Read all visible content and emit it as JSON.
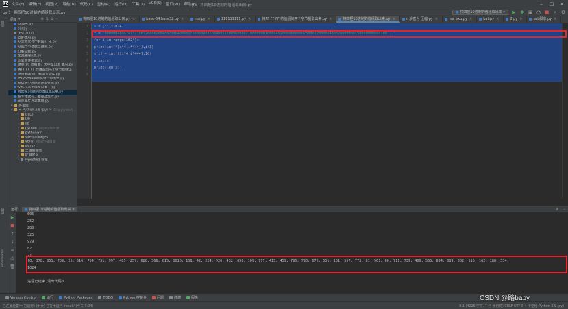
{
  "titlebar": {
    "menu": [
      "文件(F)",
      "编辑(E)",
      "视图(V)",
      "导航(N)",
      "代码(C)",
      "重构(R)",
      "运行(U)",
      "工具(T)",
      "VCS(S)",
      "窗口(W)",
      "帮助(H)"
    ],
    "title": "py - 将四把10进制的值组取出来.py"
  },
  "navbar": {
    "breadcrumb": "py 〉 将四把10进制的值组取出来.py",
    "run_config": "将四把10进制的值组取出来"
  },
  "left_strip": [
    "项目",
    "结构",
    "Bookmarks"
  ],
  "project": {
    "header": "项目",
    "tree": [
      {
        "type": "py",
        "label": "server.py"
      },
      {
        "type": "py",
        "label": "sql.py"
      },
      {
        "type": "txt",
        "label": "test16.txt"
      },
      {
        "type": "py",
        "label": "立即使用.py"
      },
      {
        "type": "py",
        "label": "从文档文件中解出n、e.py"
      },
      {
        "type": "py",
        "label": "从图片中读取二进制.py"
      },
      {
        "type": "py",
        "label": "分解因数.py"
      },
      {
        "type": "py",
        "label": "加减乘除n次.py"
      },
      {
        "type": "py",
        "label": "回复文件格式.py"
      },
      {
        "type": "py",
        "label": "读取 16 进制值、文本提出来 使用.py"
      },
      {
        "type": "py",
        "label": "将FF FF FF 的值组的两个字节提取出"
      },
      {
        "type": "py",
        "label": "批量删除5n、转换为文件.py"
      },
      {
        "type": "py",
        "label": "把base64编码部分打印出来.py"
      },
      {
        "type": "py",
        "label": "整体多个压缩包提取代码.py"
      },
      {
        "type": "py",
        "label": "文件拉字节值反过来了.py"
      },
      {
        "type": "py",
        "label": "将四把10进制的值组取出来.py",
        "selected": true
      },
      {
        "type": "py",
        "label": "解本格式化、整理成文件.py"
      },
      {
        "type": "py",
        "label": "还原图片真正宽度.py"
      },
      {
        "type": "folder",
        "label": "外部库",
        "arrow": "▾"
      },
      {
        "type": "folder",
        "label": "< Python 3.9 (py) >",
        "dim": "D:\\py\\venv\\...",
        "arrow": "▾"
      },
      {
        "type": "folder",
        "label": "DLLs",
        "arrow": "›"
      },
      {
        "type": "folder",
        "label": "Lib",
        "arrow": "›"
      },
      {
        "type": "folder",
        "label": "lib",
        "arrow": "›"
      },
      {
        "type": "folder",
        "label": "python",
        "dim": "library根目录",
        "arrow": "›"
      },
      {
        "type": "folder",
        "label": "pythonwin",
        "arrow": "›"
      },
      {
        "type": "folder",
        "label": "site-packages",
        "arrow": "›"
      },
      {
        "type": "folder",
        "label": "venv",
        "dim": "library根目录",
        "arrow": "›"
      },
      {
        "type": "folder",
        "label": "win32",
        "arrow": "›"
      },
      {
        "type": "folder",
        "label": "二进制框架",
        "arrow": "›"
      },
      {
        "type": "folder",
        "label": "扩展定义",
        "arrow": "›"
      },
      {
        "type": "txt",
        "label": "Typeshed 存根",
        "arrow": "›"
      }
    ]
  },
  "tabs": [
    {
      "label": "将四把10进制的值组取出来.py",
      "active": false
    },
    {
      "label": "base-64 base32.py",
      "active": false
    },
    {
      "label": "rsa.py",
      "active": false
    },
    {
      "label": "111111111.py",
      "active": false
    },
    {
      "label": "将FF FF FF 的值组的两个字节提取出来.py",
      "active": false
    },
    {
      "label": "将四把10进制的值组取出来.py",
      "active": true
    },
    {
      "label": "n 解密为 压缩.py",
      "active": false
    },
    {
      "label": "rsa_exp.py",
      "active": false
    },
    {
      "label": "bat.py",
      "active": false
    },
    {
      "label": "2.py",
      "active": false
    },
    {
      "label": "sub脚本.py",
      "active": false
    }
  ],
  "editor": {
    "line_numbers": [
      "1",
      "2",
      "3",
      "4",
      "5",
      "6",
      "7",
      "8"
    ],
    "line1": "s = [\"\"]*1024",
    "line2_prefix": "f = ",
    "line2_string": "'000000489670132186720006200480730040060170806090360040051000960800210080000100004920000600000750001200000400020000000150000000000100...'",
    "line3": "for i in range(1024):",
    "line4": "    print(int(f[i*4:i*4+4]),i+3)",
    "line5": "    s[i] = int(f[i*4:i*4+4],10)",
    "line6": "print(s)",
    "line7": "print(len(s))"
  },
  "run_panel": {
    "label": "运行:",
    "config": "将四把10进制的值组取出来"
  },
  "console": {
    "lines": [
      "606",
      "252",
      "280",
      "325",
      "979",
      "87",
      "21"
    ],
    "output_line1": "[0, 170, 855, 709, 25, 616, 754, 731, 997, 485, 257, 680, 566, 615, 1010, 158, 42, 224, 920, 432, 650, 109, 977, 413, 459, 795, 793, 672, 601, 161, 557, 773, 81, 561, 60, 711, 739, 409, 565, 894, 389, 302, 116, 162, 188, 534,",
    "output_line2": "1024",
    "exit": "进程已结束,退出代码0"
  },
  "bottom_tools": [
    "Version Control",
    "运行",
    "Python Packages",
    "TODO",
    "Python 控制台",
    "问题",
    "终端",
    "服务"
  ],
  "status": {
    "left": "已在此位置中(已运行) (中文) 已在中运行 'result' (今天 9:04)",
    "right": "8:1 (4226 字符, 7 行 换行符)  CRLF  UTF-8  4 个空格  Python 3.9 (py)"
  },
  "watermark": "CSDN @路baby",
  "colors": {
    "highlight_box": "#e3232d",
    "selection": "#214283",
    "keyword": "#cc7832",
    "string": "#6a8759",
    "number": "#6897bb"
  }
}
